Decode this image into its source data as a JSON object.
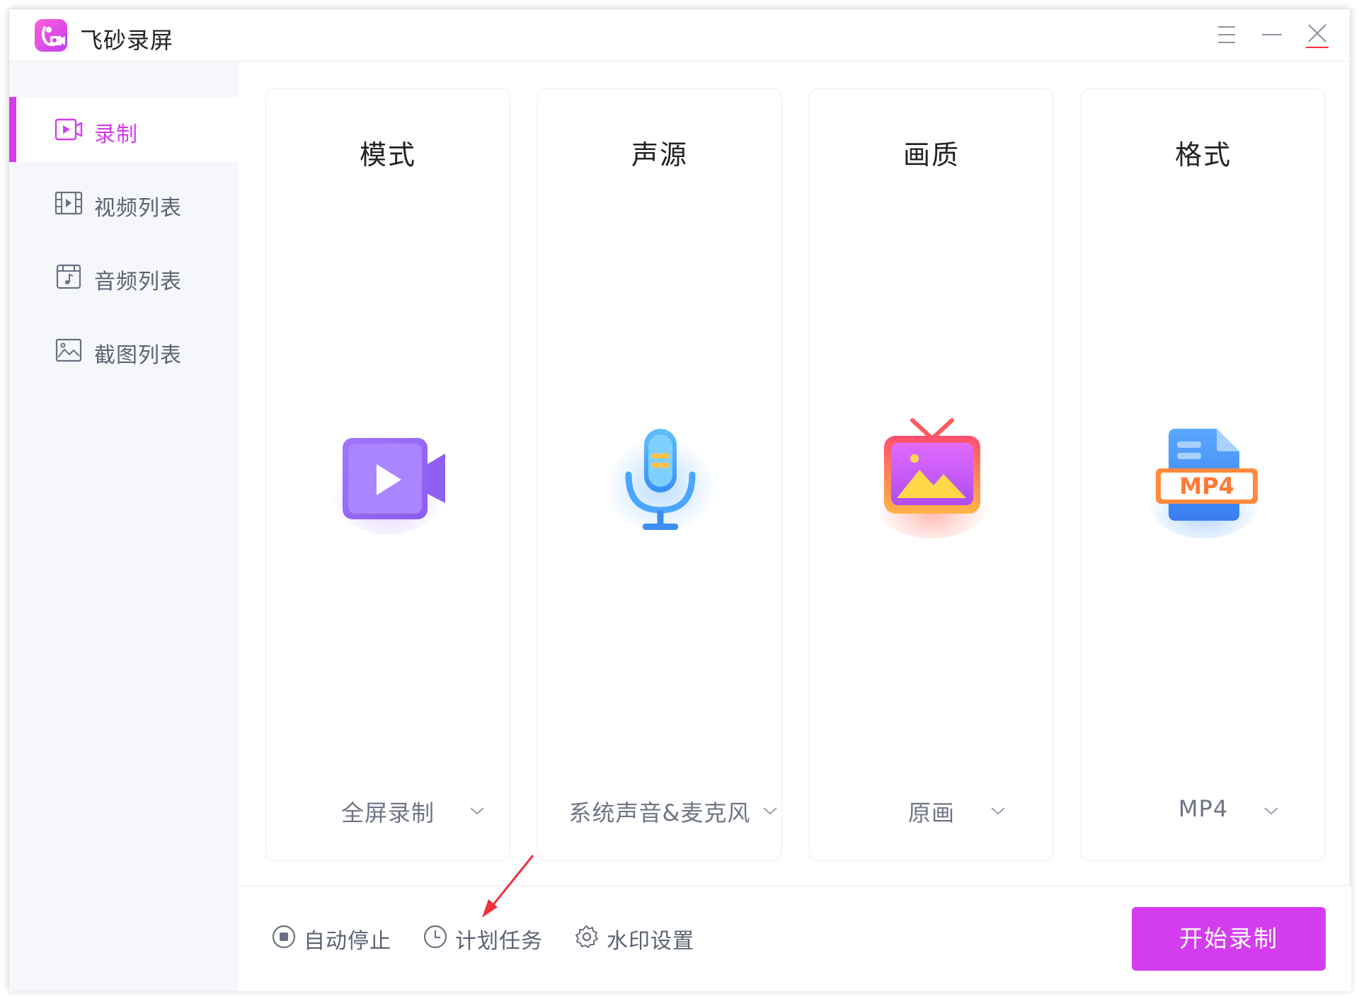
{
  "app": {
    "title": "飞砂录屏",
    "logo_icon": "feisha-logo-icon"
  },
  "titlebar": {
    "menu_icon": "hamburger-menu-icon",
    "minimize_icon": "minimize-icon",
    "close_icon": "close-icon"
  },
  "sidebar": {
    "items": [
      {
        "label": "录制",
        "icon": "video-record-icon",
        "active": true
      },
      {
        "label": "视频列表",
        "icon": "film-icon",
        "active": false
      },
      {
        "label": "音频列表",
        "icon": "music-note-icon",
        "active": false
      },
      {
        "label": "截图列表",
        "icon": "image-icon",
        "active": false
      }
    ]
  },
  "cards": [
    {
      "title": "模式",
      "icon": "video-camera-icon",
      "value": "全屏录制"
    },
    {
      "title": "声源",
      "icon": "microphone-icon",
      "value": "系统声音&麦克风"
    },
    {
      "title": "画质",
      "icon": "tv-picture-icon",
      "value": "原画"
    },
    {
      "title": "格式",
      "icon": "mp4-file-icon",
      "value": "MP4",
      "icon_text": "MP4"
    }
  ],
  "bottom": {
    "options": [
      {
        "label": "自动停止",
        "icon": "stop-circle-icon"
      },
      {
        "label": "计划任务",
        "icon": "clock-icon"
      },
      {
        "label": "水印设置",
        "icon": "gear-icon"
      }
    ],
    "start_button": "开始录制"
  },
  "colors": {
    "accent": "#d43cf0",
    "sidebar_bg": "#f6f7fb",
    "annotation_arrow": "#f0313e"
  }
}
